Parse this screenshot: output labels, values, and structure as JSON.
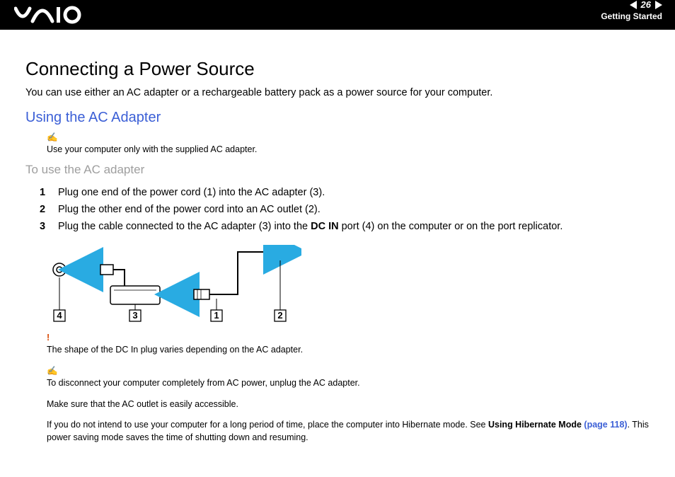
{
  "header": {
    "page_number": "26",
    "section": "Getting Started"
  },
  "title": "Connecting a Power Source",
  "intro": "You can use either an AC adapter or a rechargeable battery pack as a power source for your computer.",
  "subhead": "Using the AC Adapter",
  "note1": "Use your computer only with the supplied AC adapter.",
  "procedure_title": "To use the AC adapter",
  "steps": {
    "s1": "Plug one end of the power cord (1) into the AC adapter (3).",
    "s2": "Plug the other end of the power cord into an AC outlet (2).",
    "s3_a": "Plug the cable connected to the AC adapter (3) into the ",
    "s3_b": "DC IN",
    "s3_c": " port (4) on the computer or on the port replicator."
  },
  "callouts": {
    "c1": "1",
    "c2": "2",
    "c3": "3",
    "c4": "4"
  },
  "warn": "The shape of the DC In plug varies depending on the AC adapter.",
  "note2": "To disconnect your computer completely from AC power, unplug the AC adapter.",
  "note3": "Make sure that the AC outlet is easily accessible.",
  "note4_a": "If you do not intend to use your computer for a long period of time, place the computer into Hibernate mode. See ",
  "note4_b": "Using Hibernate Mode",
  "note4_c": " (page 118)",
  "note4_d": ". This power saving mode saves the time of shutting down and resuming."
}
